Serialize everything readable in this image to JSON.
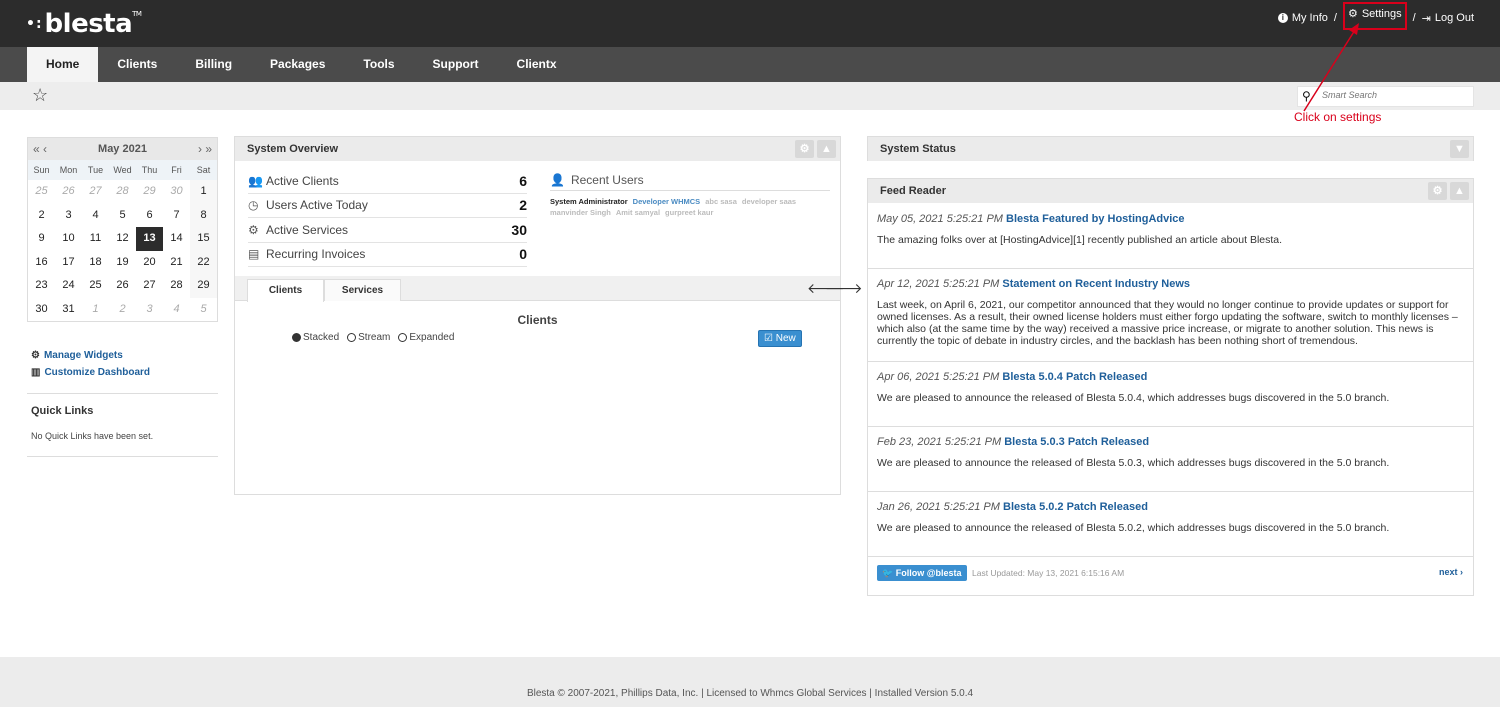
{
  "brand": {
    "name": "blesta",
    "tm": "TM"
  },
  "header": {
    "my_info": "My Info",
    "settings": "Settings",
    "logout": "Log Out",
    "separator": "/"
  },
  "nav": {
    "tabs": [
      "Home",
      "Clients",
      "Billing",
      "Packages",
      "Tools",
      "Support",
      "Clientx"
    ],
    "active": "Home"
  },
  "search": {
    "placeholder": "Smart Search"
  },
  "annotation": {
    "text": "Click on settings",
    "color": "#d9001b"
  },
  "calendar": {
    "month": "May 2021",
    "prev": "« ‹",
    "next": "› »",
    "weekdays": [
      "Sun",
      "Mon",
      "Tue",
      "Wed",
      "Thu",
      "Fri",
      "Sat"
    ],
    "weeks": [
      [
        "25",
        "26",
        "27",
        "28",
        "29",
        "30",
        "1"
      ],
      [
        "2",
        "3",
        "4",
        "5",
        "6",
        "7",
        "8"
      ],
      [
        "9",
        "10",
        "11",
        "12",
        "13",
        "14",
        "15"
      ],
      [
        "16",
        "17",
        "18",
        "19",
        "20",
        "21",
        "22"
      ],
      [
        "23",
        "24",
        "25",
        "26",
        "27",
        "28",
        "29"
      ],
      [
        "30",
        "31",
        "1",
        "2",
        "3",
        "4",
        "5"
      ]
    ],
    "today": "13"
  },
  "sidebar": {
    "manage_widgets": "Manage Widgets",
    "customize_dashboard": "Customize Dashboard",
    "quick_links_title": "Quick Links",
    "quick_links_empty": "No Quick Links have been set."
  },
  "overview": {
    "title": "System Overview",
    "stats": [
      {
        "label": "Active Clients",
        "value": "6",
        "icon": "users-icon"
      },
      {
        "label": "Users Active Today",
        "value": "2",
        "icon": "clock-icon"
      },
      {
        "label": "Active Services",
        "value": "30",
        "icon": "cogs-icon"
      },
      {
        "label": "Recurring Invoices",
        "value": "0",
        "icon": "file-icon"
      }
    ],
    "recent_users_title": "Recent Users",
    "recent_users": [
      "System Administrator",
      "Developer WHMCS",
      "abc sasa",
      "developer saas",
      "manvinder Singh",
      "Amit samyal",
      "gurpreet kaur"
    ],
    "tabs": [
      "Clients",
      "Services"
    ],
    "chart_title": "Clients",
    "views": [
      "Stacked",
      "Stream",
      "Expanded"
    ],
    "selected_view": "Stacked",
    "new_label": "New"
  },
  "status": {
    "title": "System Status"
  },
  "feed": {
    "title": "Feed Reader",
    "items": [
      {
        "date": "May 05, 2021 5:25:21 PM",
        "title": "Blesta Featured by HostingAdvice",
        "body": "The amazing folks over at [HostingAdvice][1] recently published an article about Blesta."
      },
      {
        "date": "Apr 12, 2021 5:25:21 PM",
        "title": "Statement on Recent Industry News",
        "body": "Last week, on April 6, 2021, our competitor announced that they would no longer continue to provide updates or support for owned licenses. As a result, their owned license holders must either forgo updating the software, switch to monthly licenses – which also (at the same time by the way) received a massive price increase, or migrate to another solution. This news is currently the topic of debate in industry circles, and the backlash has been nothing short of tremendous."
      },
      {
        "date": "Apr 06, 2021 5:25:21 PM",
        "title": "Blesta 5.0.4 Patch Released",
        "body": "We are pleased to announce the released of Blesta 5.0.4, which addresses bugs discovered in the 5.0 branch."
      },
      {
        "date": "Feb 23, 2021 5:25:21 PM",
        "title": "Blesta 5.0.3 Patch Released",
        "body": "We are pleased to announce the released of Blesta 5.0.3, which addresses bugs discovered in the 5.0 branch."
      },
      {
        "date": "Jan 26, 2021 5:25:21 PM",
        "title": "Blesta 5.0.2 Patch Released",
        "body": "We are pleased to announce the released of Blesta 5.0.2, which addresses bugs discovered in the 5.0 branch."
      }
    ],
    "follow": "Follow @blesta",
    "last_updated": "Last Updated: May 13, 2021 6:15:16 AM",
    "next": "next ›"
  },
  "footer": {
    "text": "Blesta © 2007-2021, Phillips Data, Inc. | Licensed to Whmcs Global Services | Installed Version 5.0.4"
  }
}
